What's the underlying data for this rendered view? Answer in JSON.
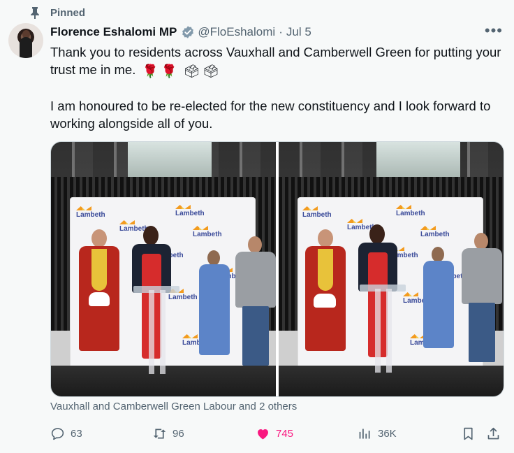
{
  "pinned": {
    "label": "Pinned",
    "icon": "pin-icon"
  },
  "author": {
    "name": "Florence Eshalomi MP",
    "handle": "@FloEshalomi",
    "separator": "·",
    "date": "Jul 5",
    "verified_icon": "verified-badge-icon",
    "avatar_icon": "avatar"
  },
  "more_icon": "more-options-icon",
  "post": {
    "line1": "Thank you to residents across Vauxhall and Camberwell Green for putting your trust me in me.",
    "emoji": [
      "🌹",
      "🌹",
      "🗳",
      "🗳"
    ],
    "line2": "I am honoured to be re-elected for the new constituency and I look forward to working alongside all of you."
  },
  "media": {
    "backdrop_logo_text": "Lambeth",
    "photos": [
      "photo-left",
      "photo-right"
    ]
  },
  "caption": "Vauxhall and Camberwell Green Labour and 2 others",
  "actions": {
    "replies": "63",
    "reposts": "96",
    "likes": "745",
    "views": "36K"
  },
  "colors": {
    "background": "#f7f9f9",
    "text": "#0f1419",
    "secondary": "#536471",
    "verified": "#829aab",
    "like": "#f91880"
  }
}
